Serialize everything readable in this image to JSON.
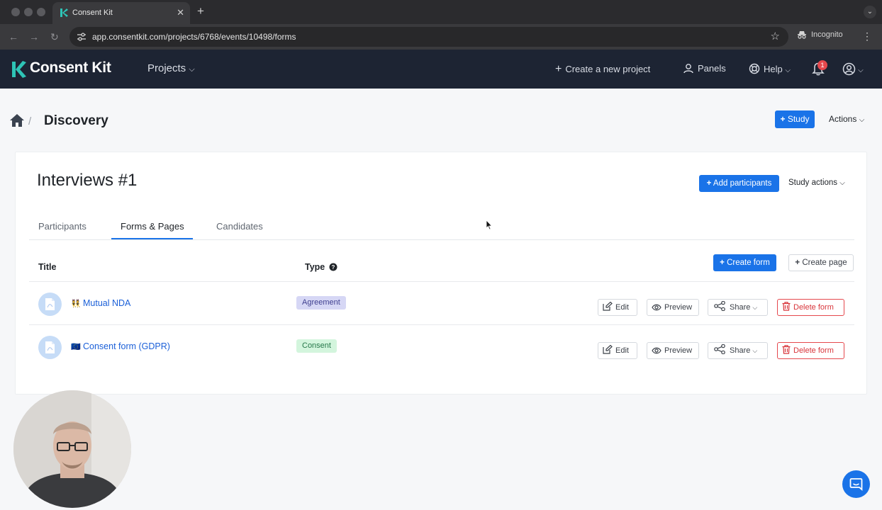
{
  "browser": {
    "tab_title": "Consent Kit",
    "url": "app.consentkit.com/projects/6768/events/10498/forms",
    "incognito_label": "Incognito"
  },
  "app": {
    "brand": "Consent Kit",
    "nav": {
      "projects": "Projects",
      "create_project": "Create a new project",
      "panels": "Panels",
      "help": "Help",
      "notification_count": "1"
    }
  },
  "page": {
    "title": "Discovery",
    "study_button": "Study",
    "actions_label": "Actions"
  },
  "study": {
    "title": "Interviews #1",
    "add_participants": "Add participants",
    "study_actions": "Study actions",
    "tabs": [
      "Participants",
      "Forms & Pages",
      "Candidates"
    ],
    "active_tab": "Forms & Pages"
  },
  "table": {
    "headers": {
      "title": "Title",
      "type": "Type"
    },
    "create_form": "Create form",
    "create_page": "Create page",
    "rows": [
      {
        "emoji": "👯",
        "title": "Mutual NDA",
        "type": "Agreement"
      },
      {
        "emoji": "🇪🇺",
        "title": "Consent form (GDPR)",
        "type": "Consent"
      }
    ],
    "row_actions": {
      "edit": "Edit",
      "preview": "Preview",
      "share": "Share",
      "delete": "Delete form"
    }
  },
  "colors": {
    "primary": "#1a73e8",
    "header_bg": "#1d2433",
    "brand_accent": "#2ec4b6",
    "danger": "#e5484d",
    "badge_agreement": "#d6d7f5",
    "badge_consent": "#d3f5dd"
  }
}
